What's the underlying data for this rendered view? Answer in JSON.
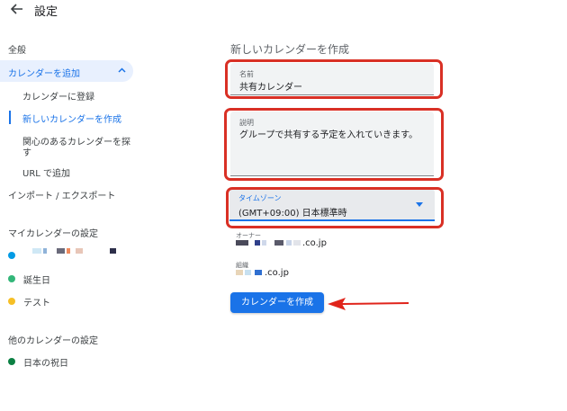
{
  "header": {
    "title": "設定",
    "back_icon": "arrow-left-icon"
  },
  "sidebar": {
    "general": "全般",
    "add_calendar": "カレンダーを追加",
    "sub_items": [
      {
        "label": "カレンダーに登録",
        "active": false
      },
      {
        "label": "新しいカレンダーを作成",
        "active": true
      },
      {
        "label": "関心のあるカレンダーを探",
        "label_line2": "す",
        "active": false
      },
      {
        "label": "URL で追加",
        "active": false
      }
    ],
    "import_export": "インポート / エクスポート",
    "my_calendars_heading": "マイカレンダーの設定",
    "my_calendars": [
      {
        "label": "",
        "color": "#039be5",
        "redacted": true
      },
      {
        "label": "誕生日",
        "color": "#33b679"
      },
      {
        "label": "テスト",
        "color": "#f6bf26"
      }
    ],
    "other_calendars_heading": "他のカレンダーの設定",
    "other_calendars": [
      {
        "label": "日本の祝日",
        "color": "#0b8043"
      }
    ]
  },
  "form": {
    "title": "新しいカレンダーを作成",
    "name_label": "名前",
    "name_value": "共有カレンダー",
    "description_label": "説明",
    "description_value": "グループで共有する予定を入れていきます。",
    "timezone_label": "タイムゾーン",
    "timezone_value": "(GMT+09:00) 日本標準時",
    "owner_label": "オーナー",
    "owner_domain": ".co.jp",
    "org_label": "組織",
    "org_domain": ".co.jp",
    "create_button": "カレンダーを作成"
  },
  "colors": {
    "accent": "#1a73e8",
    "highlight": "#d93025",
    "field_bg": "#f1f3f4"
  }
}
